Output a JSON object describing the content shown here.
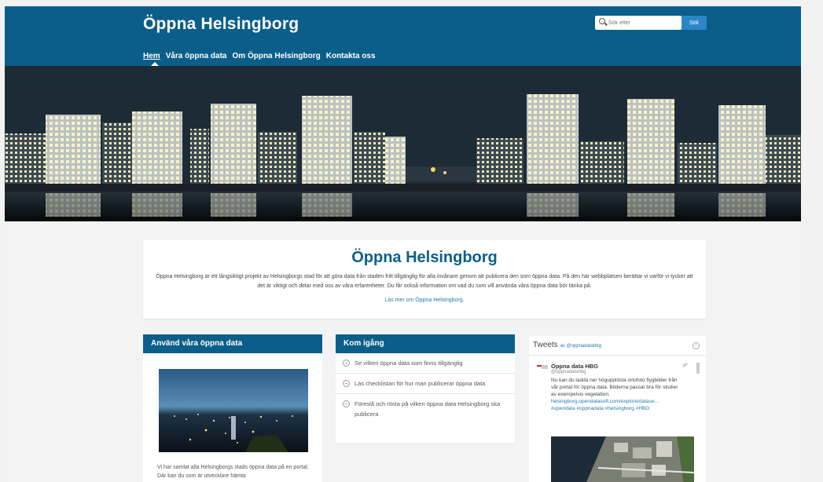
{
  "site": {
    "title": "Öppna Helsingborg",
    "search_placeholder": "Sök efter",
    "search_button": "Sök"
  },
  "nav": [
    "Hem",
    "Våra öppna data",
    "Om Öppna Helsingborg",
    "Kontakta oss"
  ],
  "intro": {
    "heading": "Öppna Helsingborg",
    "body": "Öppna Helsingborg är ett långsiktigt projekt av Helsingborgs stad för att göra data från staden fritt tillgänglig för alla invånare genom att publicera den som öppna data. På den här webbplatsen berättar vi varför vi tycker att det är viktigt och delar med oss av våra erfarenheter. Du får också information om vad du som vill använda våra öppna data bör tänka på.",
    "link": "Läs mer om Öppna Helsingborg."
  },
  "card_use": {
    "title": "Använd våra öppna data",
    "text": "Vi har samlat alla Helsingborgs stads öppna data på en portal. Där kan du som är utvecklare hämta"
  },
  "card_start": {
    "title": "Kom igång",
    "items": [
      "Se vilken öppna data som finns tillgänglig",
      "Läs checklistan för hur man publicerar öppna data",
      "Föreslå och rösta på vilken öppna data Helsingborg ska publicera"
    ]
  },
  "tweets": {
    "title": "Tweets",
    "by": "av @oppnadatahbg",
    "name": "Öppna data HBG",
    "handle": "@oppnadatahbg",
    "text": "Nu kan du ladda ner högupplösta ortofoto flygbilder från vår portal för öppna data. Bilderna passar bra för studier av exempelvis vegetation.",
    "links": "helsingborg.opendatasoft.com/explore/datase… #opendata #oppnadata #helsingborg #HBG",
    "icon_info": "info-icon"
  },
  "colors": {
    "header": "#0b5e8a",
    "accent": "#2a86c6",
    "card_head": "#0b5e8a",
    "link": "#2a7bb0"
  }
}
